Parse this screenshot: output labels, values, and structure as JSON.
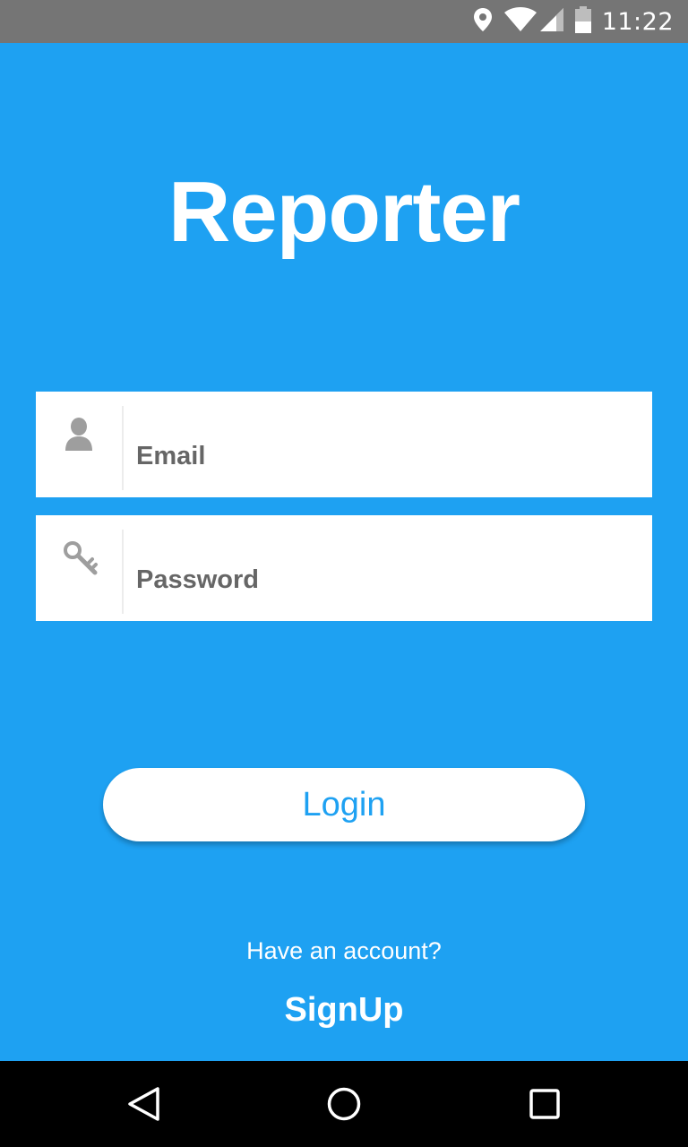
{
  "status_bar": {
    "time": "11:22",
    "icons": [
      "location-icon",
      "wifi-icon",
      "signal-icon",
      "battery-icon"
    ]
  },
  "app": {
    "title": "Reporter"
  },
  "form": {
    "email": {
      "placeholder": "Email",
      "value": "",
      "icon": "user-icon"
    },
    "password": {
      "placeholder": "Password",
      "value": "",
      "icon": "key-icon"
    },
    "login_label": "Login"
  },
  "footer": {
    "prompt": "Have an account?",
    "signup_label": "SignUp"
  },
  "nav_bar": {
    "icons": [
      "back-icon",
      "home-icon",
      "recents-icon"
    ]
  },
  "colors": {
    "background": "#1ea1f2",
    "status_bar": "#757575",
    "field_text": "#666666",
    "icon_gray": "#9e9e9e",
    "nav_bar": "#000000"
  }
}
